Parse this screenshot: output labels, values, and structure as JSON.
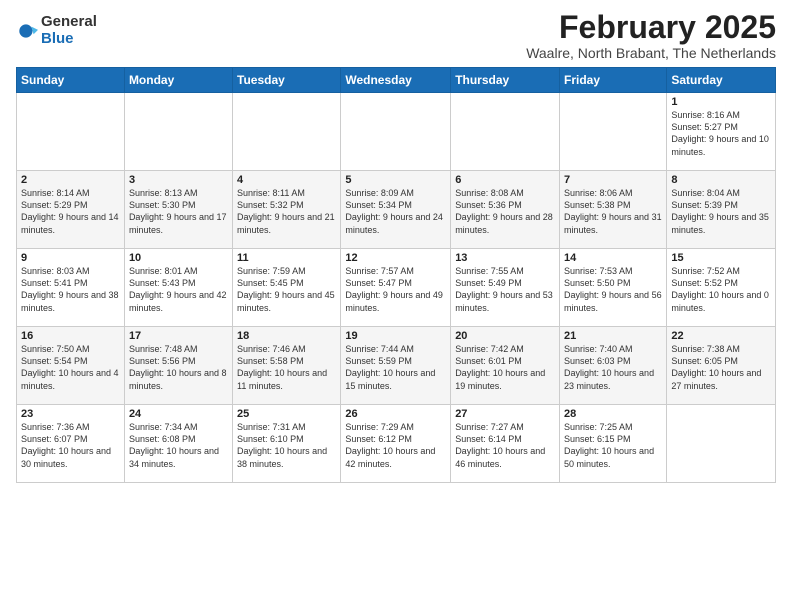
{
  "logo": {
    "general": "General",
    "blue": "Blue"
  },
  "title": "February 2025",
  "location": "Waalre, North Brabant, The Netherlands",
  "weekdays": [
    "Sunday",
    "Monday",
    "Tuesday",
    "Wednesday",
    "Thursday",
    "Friday",
    "Saturday"
  ],
  "weeks": [
    [
      {
        "day": "",
        "info": ""
      },
      {
        "day": "",
        "info": ""
      },
      {
        "day": "",
        "info": ""
      },
      {
        "day": "",
        "info": ""
      },
      {
        "day": "",
        "info": ""
      },
      {
        "day": "",
        "info": ""
      },
      {
        "day": "1",
        "info": "Sunrise: 8:16 AM\nSunset: 5:27 PM\nDaylight: 9 hours and 10 minutes."
      }
    ],
    [
      {
        "day": "2",
        "info": "Sunrise: 8:14 AM\nSunset: 5:29 PM\nDaylight: 9 hours and 14 minutes."
      },
      {
        "day": "3",
        "info": "Sunrise: 8:13 AM\nSunset: 5:30 PM\nDaylight: 9 hours and 17 minutes."
      },
      {
        "day": "4",
        "info": "Sunrise: 8:11 AM\nSunset: 5:32 PM\nDaylight: 9 hours and 21 minutes."
      },
      {
        "day": "5",
        "info": "Sunrise: 8:09 AM\nSunset: 5:34 PM\nDaylight: 9 hours and 24 minutes."
      },
      {
        "day": "6",
        "info": "Sunrise: 8:08 AM\nSunset: 5:36 PM\nDaylight: 9 hours and 28 minutes."
      },
      {
        "day": "7",
        "info": "Sunrise: 8:06 AM\nSunset: 5:38 PM\nDaylight: 9 hours and 31 minutes."
      },
      {
        "day": "8",
        "info": "Sunrise: 8:04 AM\nSunset: 5:39 PM\nDaylight: 9 hours and 35 minutes."
      }
    ],
    [
      {
        "day": "9",
        "info": "Sunrise: 8:03 AM\nSunset: 5:41 PM\nDaylight: 9 hours and 38 minutes."
      },
      {
        "day": "10",
        "info": "Sunrise: 8:01 AM\nSunset: 5:43 PM\nDaylight: 9 hours and 42 minutes."
      },
      {
        "day": "11",
        "info": "Sunrise: 7:59 AM\nSunset: 5:45 PM\nDaylight: 9 hours and 45 minutes."
      },
      {
        "day": "12",
        "info": "Sunrise: 7:57 AM\nSunset: 5:47 PM\nDaylight: 9 hours and 49 minutes."
      },
      {
        "day": "13",
        "info": "Sunrise: 7:55 AM\nSunset: 5:49 PM\nDaylight: 9 hours and 53 minutes."
      },
      {
        "day": "14",
        "info": "Sunrise: 7:53 AM\nSunset: 5:50 PM\nDaylight: 9 hours and 56 minutes."
      },
      {
        "day": "15",
        "info": "Sunrise: 7:52 AM\nSunset: 5:52 PM\nDaylight: 10 hours and 0 minutes."
      }
    ],
    [
      {
        "day": "16",
        "info": "Sunrise: 7:50 AM\nSunset: 5:54 PM\nDaylight: 10 hours and 4 minutes."
      },
      {
        "day": "17",
        "info": "Sunrise: 7:48 AM\nSunset: 5:56 PM\nDaylight: 10 hours and 8 minutes."
      },
      {
        "day": "18",
        "info": "Sunrise: 7:46 AM\nSunset: 5:58 PM\nDaylight: 10 hours and 11 minutes."
      },
      {
        "day": "19",
        "info": "Sunrise: 7:44 AM\nSunset: 5:59 PM\nDaylight: 10 hours and 15 minutes."
      },
      {
        "day": "20",
        "info": "Sunrise: 7:42 AM\nSunset: 6:01 PM\nDaylight: 10 hours and 19 minutes."
      },
      {
        "day": "21",
        "info": "Sunrise: 7:40 AM\nSunset: 6:03 PM\nDaylight: 10 hours and 23 minutes."
      },
      {
        "day": "22",
        "info": "Sunrise: 7:38 AM\nSunset: 6:05 PM\nDaylight: 10 hours and 27 minutes."
      }
    ],
    [
      {
        "day": "23",
        "info": "Sunrise: 7:36 AM\nSunset: 6:07 PM\nDaylight: 10 hours and 30 minutes."
      },
      {
        "day": "24",
        "info": "Sunrise: 7:34 AM\nSunset: 6:08 PM\nDaylight: 10 hours and 34 minutes."
      },
      {
        "day": "25",
        "info": "Sunrise: 7:31 AM\nSunset: 6:10 PM\nDaylight: 10 hours and 38 minutes."
      },
      {
        "day": "26",
        "info": "Sunrise: 7:29 AM\nSunset: 6:12 PM\nDaylight: 10 hours and 42 minutes."
      },
      {
        "day": "27",
        "info": "Sunrise: 7:27 AM\nSunset: 6:14 PM\nDaylight: 10 hours and 46 minutes."
      },
      {
        "day": "28",
        "info": "Sunrise: 7:25 AM\nSunset: 6:15 PM\nDaylight: 10 hours and 50 minutes."
      },
      {
        "day": "",
        "info": ""
      }
    ]
  ]
}
